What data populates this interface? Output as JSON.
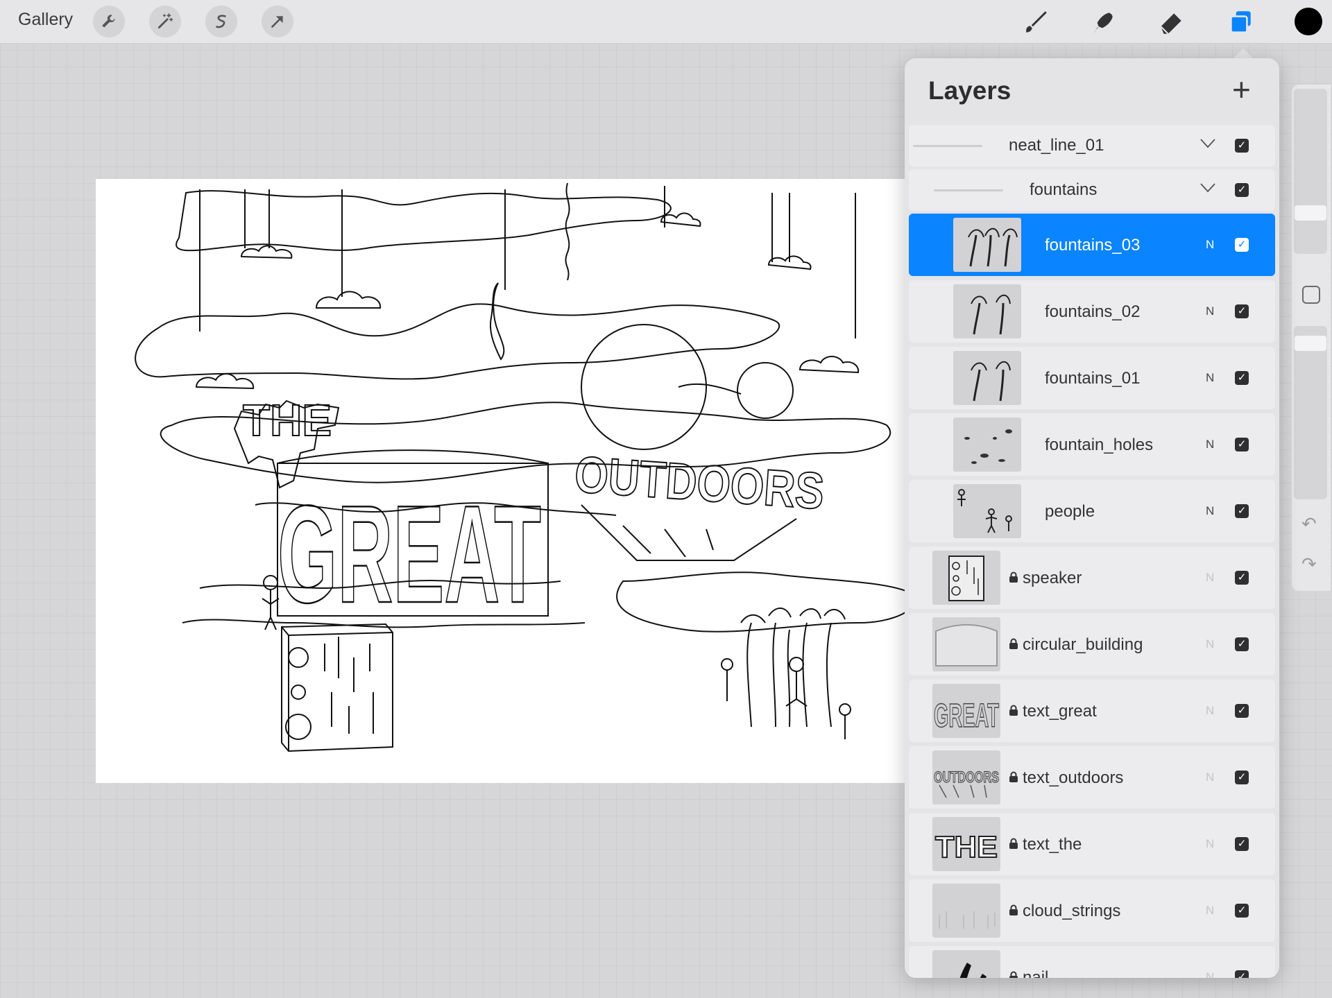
{
  "topbar": {
    "gallery_label": "Gallery",
    "left_tools": [
      "wrench-icon",
      "magic-wand-icon",
      "selection-icon",
      "transform-arrow-icon"
    ],
    "right_tools": [
      "brush-icon",
      "smudge-icon",
      "eraser-icon",
      "layers-icon"
    ],
    "active_color": "#000000",
    "accent_color": "#0a84ff"
  },
  "layers_panel": {
    "title": "Layers",
    "add_label": "+",
    "rows": [
      {
        "type": "group",
        "name": "neat_line_01",
        "visible": true
      },
      {
        "type": "group",
        "name": "fountains",
        "visible": true
      },
      {
        "type": "layer",
        "name": "fountains_03",
        "mode": "N",
        "visible": true,
        "selected": true,
        "locked": false,
        "thumb": "fountains3"
      },
      {
        "type": "layer",
        "name": "fountains_02",
        "mode": "N",
        "visible": true,
        "locked": false,
        "thumb": "fountains2"
      },
      {
        "type": "layer",
        "name": "fountains_01",
        "mode": "N",
        "visible": true,
        "locked": false,
        "thumb": "fountains2"
      },
      {
        "type": "layer",
        "name": "fountain_holes",
        "mode": "N",
        "visible": true,
        "locked": false,
        "thumb": "holes"
      },
      {
        "type": "layer",
        "name": "people",
        "mode": "N",
        "visible": true,
        "locked": false,
        "thumb": "people"
      },
      {
        "type": "layer",
        "name": "speaker",
        "mode": "N",
        "visible": true,
        "locked": true,
        "thumb": "speaker"
      },
      {
        "type": "layer",
        "name": "circular_building",
        "mode": "N",
        "visible": true,
        "locked": true,
        "thumb": "building"
      },
      {
        "type": "layer",
        "name": "text_great",
        "mode": "N",
        "visible": true,
        "locked": true,
        "thumb": "great"
      },
      {
        "type": "layer",
        "name": "text_outdoors",
        "mode": "N",
        "visible": true,
        "locked": true,
        "thumb": "outdoors"
      },
      {
        "type": "layer",
        "name": "text_the",
        "mode": "N",
        "visible": true,
        "locked": true,
        "thumb": "the"
      },
      {
        "type": "layer",
        "name": "cloud_strings",
        "mode": "N",
        "visible": true,
        "locked": true,
        "thumb": "strings"
      },
      {
        "type": "layer",
        "name": "nail",
        "mode": "N",
        "visible": true,
        "locked": true,
        "thumb": "nail"
      }
    ]
  },
  "sidebar": {
    "icons": [
      "modify-square-icon",
      "undo-icon",
      "redo-icon"
    ]
  },
  "canvas": {
    "artwork_text": [
      "THE",
      "GREAT",
      "OUTDOORS"
    ]
  }
}
